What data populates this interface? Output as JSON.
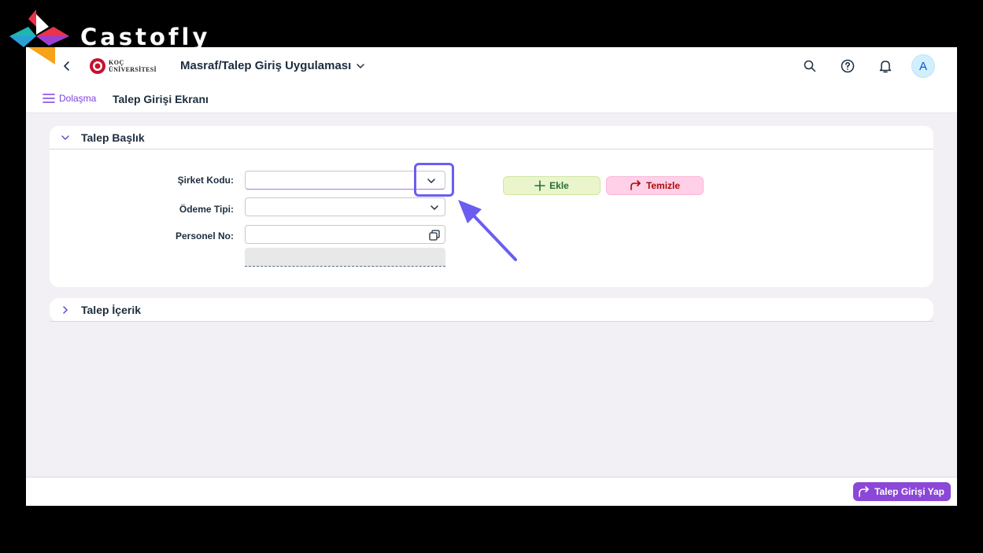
{
  "watermark": {
    "text": "Castofly"
  },
  "shell": {
    "logo_line1": "KOÇ",
    "logo_line2": "ÜNİVERSİTESİ",
    "app_title": "Masraf/Talep Giriş Uygulaması",
    "avatar_initial": "A",
    "icons": [
      "back-icon",
      "search-icon",
      "help-icon",
      "bell-icon"
    ]
  },
  "subheader": {
    "nav_label": "Dolaşma",
    "page_title": "Talep Girişi Ekranı"
  },
  "panels": {
    "header_panel": {
      "title": "Talep Başlık",
      "expanded": true
    },
    "content_panel": {
      "title": "Talep İçerik",
      "expanded": false
    }
  },
  "form": {
    "company_code": {
      "label": "Şirket Kodu:",
      "value": ""
    },
    "payment_type": {
      "label": "Ödeme Tipi:",
      "value": ""
    },
    "personnel_no": {
      "label": "Personel No:",
      "value": ""
    }
  },
  "actions": {
    "add_label": "Ekle",
    "clear_label": "Temizle",
    "submit_label": "Talep Girişi Yap"
  },
  "colors": {
    "accent": "#7c3fe4",
    "annotation": "#6a5ef0",
    "add_bg": "#ebf5cb",
    "clear_bg": "#ffd0e7",
    "submit_bg": "#8b47d7"
  }
}
